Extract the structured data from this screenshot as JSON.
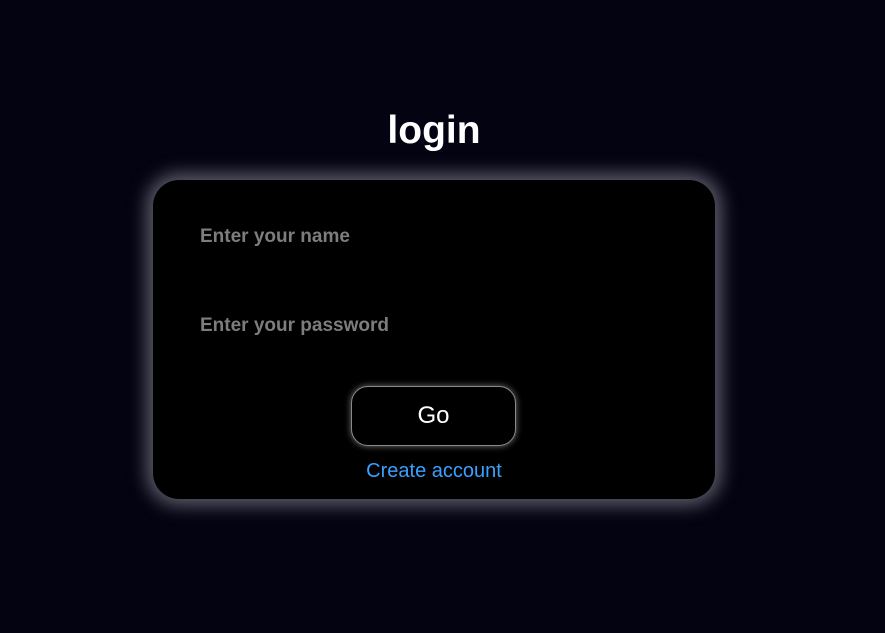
{
  "page": {
    "title": "login"
  },
  "form": {
    "name_placeholder": "Enter your name",
    "name_value": "",
    "password_placeholder": "Enter your password",
    "password_value": "",
    "submit_label": "Go",
    "create_account_label": "Create account"
  },
  "colors": {
    "background": "#030312",
    "card": "#000000",
    "title_text": "#ffffff",
    "placeholder_text": "#7d7d7d",
    "link": "#3aa0ff",
    "card_glow": "#aaaab4"
  }
}
